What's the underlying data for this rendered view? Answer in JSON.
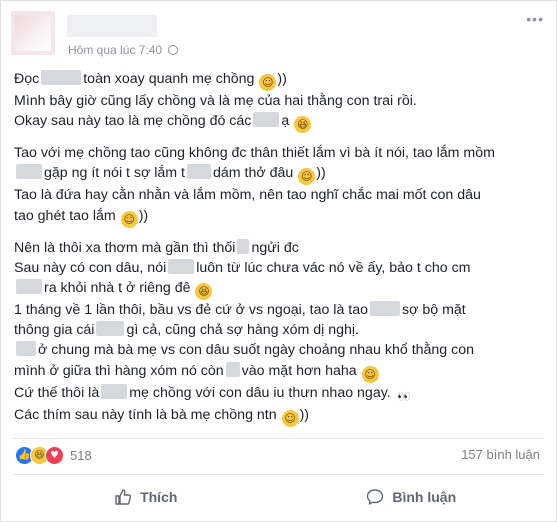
{
  "post": {
    "timestamp": "Hôm qua lúc 7:40",
    "paragraphs": [
      {
        "lines": [
          [
            {
              "t": "Đọc"
            },
            {
              "blur": 40
            },
            {
              "t": "toàn xoay quanh mẹ chồng "
            },
            {
              "emoji": "smile"
            },
            {
              "t": "))"
            }
          ],
          [
            {
              "t": "Mình bây giờ cũng lấy chồng và là mẹ của hai thằng con trai rồi."
            }
          ],
          [
            {
              "t": "Okay sau này tao là mẹ chồng đó các"
            },
            {
              "blur": 26
            },
            {
              "t": "ạ "
            },
            {
              "emoji": "laugh"
            }
          ]
        ]
      },
      {
        "lines": [
          [
            {
              "t": "Tao với mẹ chồng tao cũng không đc thân thiết lắm vì bà ít nói, tao lắm mồm"
            }
          ],
          [
            {
              "blur": 26
            },
            {
              "t": "gặp ng ít nói t sợ lắm t"
            },
            {
              "blur": 24
            },
            {
              "t": "dám thở đâu "
            },
            {
              "emoji": "smile"
            },
            {
              "t": "))"
            }
          ],
          [
            {
              "t": "Tao là đứa hay cằn nhằn và lắm mồm, nên tao nghĩ chắc mai mốt con dâu"
            }
          ],
          [
            {
              "t": "tao ghét tao lắm "
            },
            {
              "emoji": "smile"
            },
            {
              "t": "))"
            }
          ]
        ]
      },
      {
        "lines": [
          [
            {
              "t": "Nên là thôi xa thơm mà gần thì thối"
            },
            {
              "blur": 12
            },
            {
              "t": "ngửi đc"
            }
          ],
          [
            {
              "t": "Sau này có con dâu, nói"
            },
            {
              "blur": 26
            },
            {
              "t": "luôn từ lúc chưa vác nó về ấy, bảo t cho cm"
            }
          ],
          [
            {
              "blur": 26
            },
            {
              "t": "ra khỏi nhà t ở riêng đê "
            },
            {
              "emoji": "laugh"
            }
          ],
          [
            {
              "t": "1 tháng về 1 lần thôi, bầu vs đẻ cứ ở vs ngoại, tao là tao"
            },
            {
              "blur": 30
            },
            {
              "t": "sợ bộ mặt"
            }
          ],
          [
            {
              "t": "thông gia cái"
            },
            {
              "blur": 28
            },
            {
              "t": "gì cả, cũng chả sợ hàng xóm dị nghị."
            }
          ],
          [
            {
              "blur": 20
            },
            {
              "t": "ở chung mà bà mẹ vs con dâu suốt ngày choảng nhau khổ thằng con"
            }
          ],
          [
            {
              "t": "mình ở giữa thì hàng xóm nó còn"
            },
            {
              "blur": 14
            },
            {
              "t": "vào mặt hơn haha "
            },
            {
              "emoji": "smile"
            }
          ],
          [
            {
              "t": "Cứ thế thôi là"
            },
            {
              "blur": 26
            },
            {
              "t": "mẹ chồng với con dâu iu thưn nhao ngay. "
            },
            {
              "emoji": "eyes"
            }
          ],
          [
            {
              "t": "Các thím sau này tính là bà mẹ chồng ntn "
            },
            {
              "emoji": "smile"
            },
            {
              "t": "))"
            }
          ]
        ]
      }
    ]
  },
  "emoji_glyphs": {
    "smile": "☺",
    "laugh": "😆",
    "eyes": "👀"
  },
  "stats": {
    "reaction_count": "518",
    "comments": "157 bình luận"
  },
  "actions": {
    "like_label": "Thích",
    "comment_label": "Bình luận"
  },
  "colors": {
    "like_blue": "#2078f4",
    "haha_yellow": "#f9c73e",
    "love_red": "#f33e58"
  }
}
